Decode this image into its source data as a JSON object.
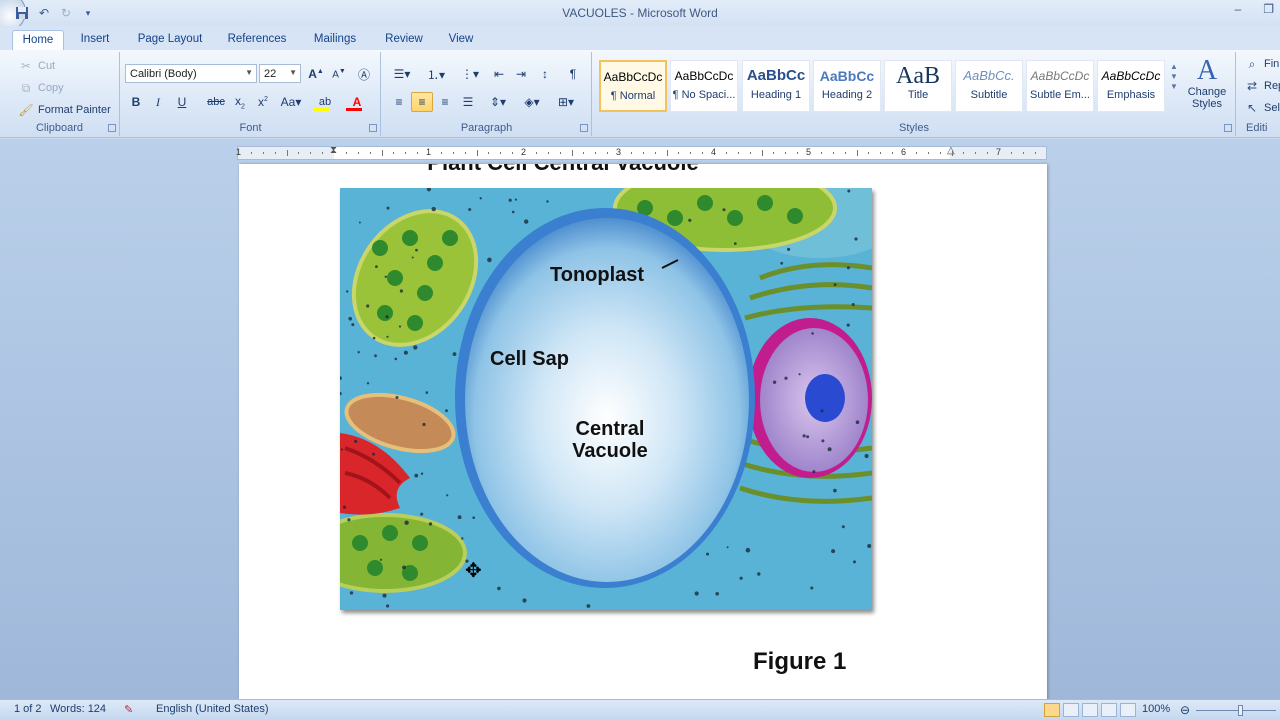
{
  "window": {
    "title": "VACUOLES - Microsoft Word"
  },
  "tabs": [
    {
      "label": "Home",
      "active": true
    },
    {
      "label": "Insert"
    },
    {
      "label": "Page Layout"
    },
    {
      "label": "References"
    },
    {
      "label": "Mailings"
    },
    {
      "label": "Review"
    },
    {
      "label": "View"
    }
  ],
  "clipboard": {
    "cut": "Cut",
    "copy": "Copy",
    "format_painter": "Format Painter",
    "label": "Clipboard"
  },
  "font": {
    "name": "Calibri (Body)",
    "size": "22",
    "label": "Font",
    "accent_color": "#ff0000",
    "highlight_color": "#ffff00"
  },
  "paragraph": {
    "label": "Paragraph"
  },
  "styles": {
    "label": "Styles",
    "items": [
      {
        "sample": "AaBbCcDc",
        "name": "¶ Normal",
        "selected": true
      },
      {
        "sample": "AaBbCcDc",
        "name": "¶ No Spaci..."
      },
      {
        "sample": "AaBbCc",
        "name": "Heading 1"
      },
      {
        "sample": "AaBbCc",
        "name": "Heading 2"
      },
      {
        "sample": "AaB",
        "name": "Title"
      },
      {
        "sample": "AaBbCc.",
        "name": "Subtitle"
      },
      {
        "sample": "AaBbCcDc",
        "name": "Subtle Em..."
      },
      {
        "sample": "AaBbCcDc",
        "name": "Emphasis"
      }
    ],
    "change_styles": "Change Styles"
  },
  "editing": {
    "find": "Fin",
    "replace": "Rep",
    "select": "Sel",
    "label": "Editi"
  },
  "ruler": {
    "numbers": [
      "1",
      "1",
      "2",
      "3",
      "4",
      "5",
      "6",
      "7"
    ]
  },
  "document": {
    "heading": "Plant Cell Central Vacuole",
    "figure_labels": {
      "tonoplast": "Tonoplast",
      "cell_sap": "Cell Sap",
      "central_vacuole_1": "Central",
      "central_vacuole_2": "Vacuole"
    },
    "caption": "Figure 1"
  },
  "status": {
    "page": "1 of 2",
    "words": "Words: 124",
    "language": "English (United States)",
    "zoom": "100%"
  }
}
